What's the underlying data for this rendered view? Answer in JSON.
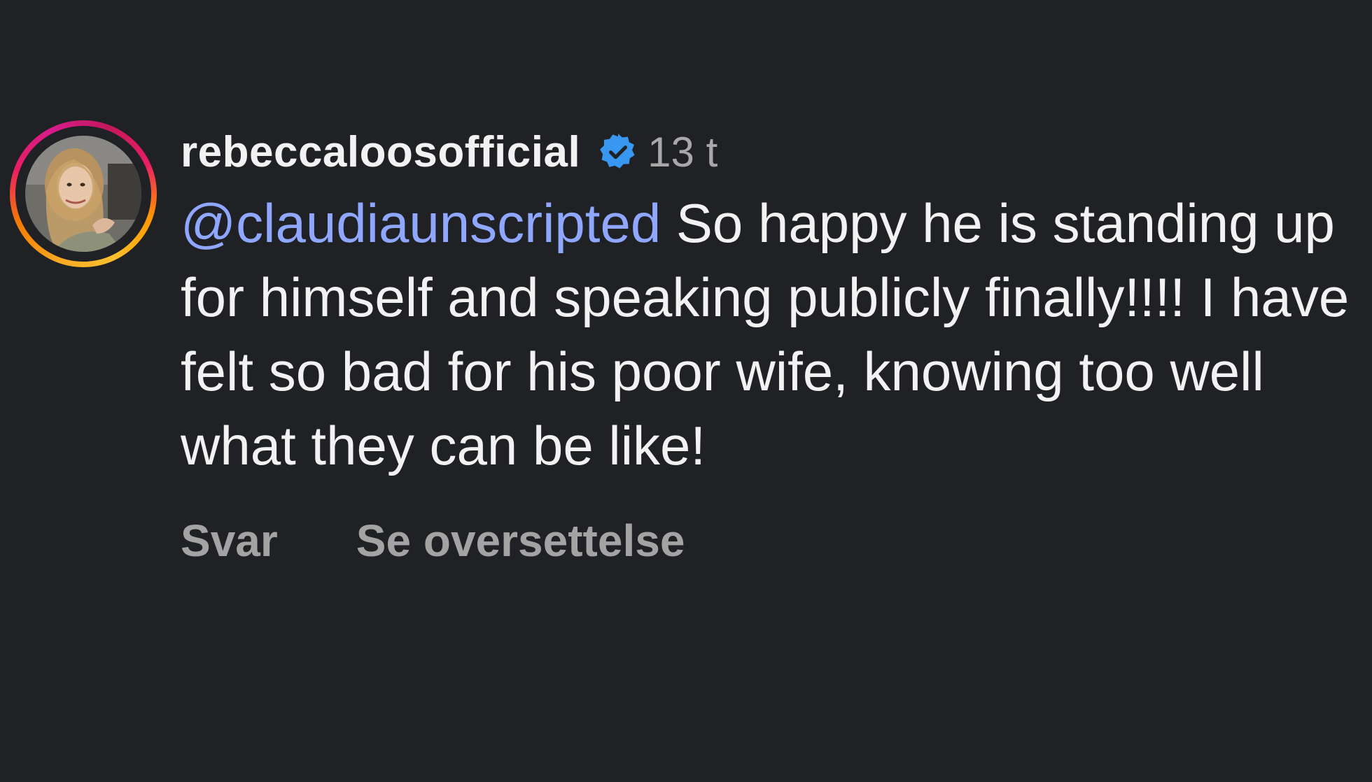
{
  "comment": {
    "username": "rebeccaloosofficial",
    "verified_icon": "verified-badge-icon",
    "timestamp": "13 t",
    "mention": "@claudiaunscripted",
    "text": " So happy he is standing up for himself and speaking publicly finally!!!! I have felt so bad for his poor wife, knowing too well what they can be like!",
    "actions": {
      "reply": "Svar",
      "translate": "Se oversettelse"
    }
  },
  "colors": {
    "background": "#1f2124",
    "mention": "#8fa7ff",
    "verified_badge": "#3897f0",
    "meta_text": "#a3a3a3",
    "story_ring_start": "#f9a825",
    "story_ring_end": "#d81b8c"
  }
}
